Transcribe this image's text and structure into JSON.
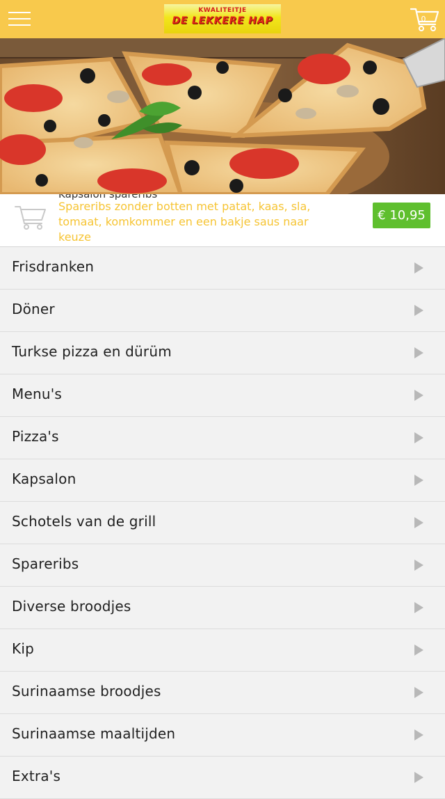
{
  "header": {
    "logo_line1": "KWALITEITJE",
    "logo_line2": "DE LEKKERE HAP",
    "cart_count": "0",
    "colors": {
      "bar": "#f8c94c",
      "icons": "#ffffff"
    },
    "icons": {
      "menu": "hamburger-icon",
      "cart": "shopping-cart-icon"
    }
  },
  "hero": {
    "image": "pizza-slices-photo"
  },
  "featured_product": {
    "title": "Kapsalon spareribs",
    "description": "Spareribs zonder botten met patat, kaas, sla, tomaat, komkommer en een bakje saus naar keuze",
    "price": "€ 10,95",
    "colors": {
      "description": "#f6c433",
      "price_bg": "#5fbf2e"
    },
    "icon": "shopping-cart-icon"
  },
  "menu": {
    "items": [
      {
        "label": "Frisdranken"
      },
      {
        "label": "Döner"
      },
      {
        "label": "Turkse pizza en dürüm"
      },
      {
        "label": "Menu's"
      },
      {
        "label": "Pizza's"
      },
      {
        "label": "Kapsalon"
      },
      {
        "label": "Schotels van de grill"
      },
      {
        "label": "Spareribs"
      },
      {
        "label": "Diverse broodjes"
      },
      {
        "label": "Kip"
      },
      {
        "label": "Surinaamse broodjes"
      },
      {
        "label": "Surinaamse maaltijden"
      },
      {
        "label": "Extra's"
      }
    ],
    "arrow_icon": "chevron-right-icon"
  }
}
